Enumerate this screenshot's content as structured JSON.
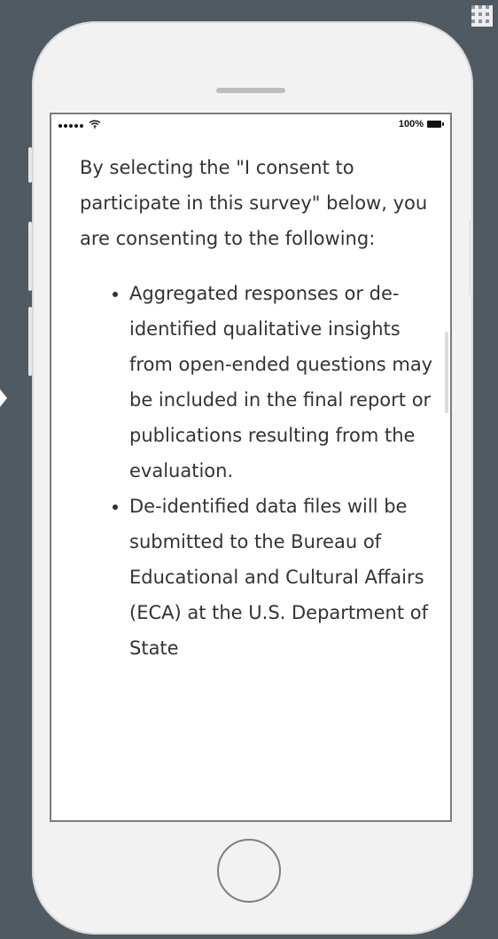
{
  "status_bar": {
    "battery_text": "100%"
  },
  "content": {
    "intro": "By selecting the \"I consent to participate in this survey\" below, you are consenting to the following:",
    "bullets": [
      "Aggregated responses or de-identified qualitative insights from open-ended questions may be included in the final report or publications resulting from the evaluation.",
      "De-identified data files will be submitted to the Bureau of Educational and Cultural Affairs (ECA) at the U.S. Department of State"
    ]
  }
}
